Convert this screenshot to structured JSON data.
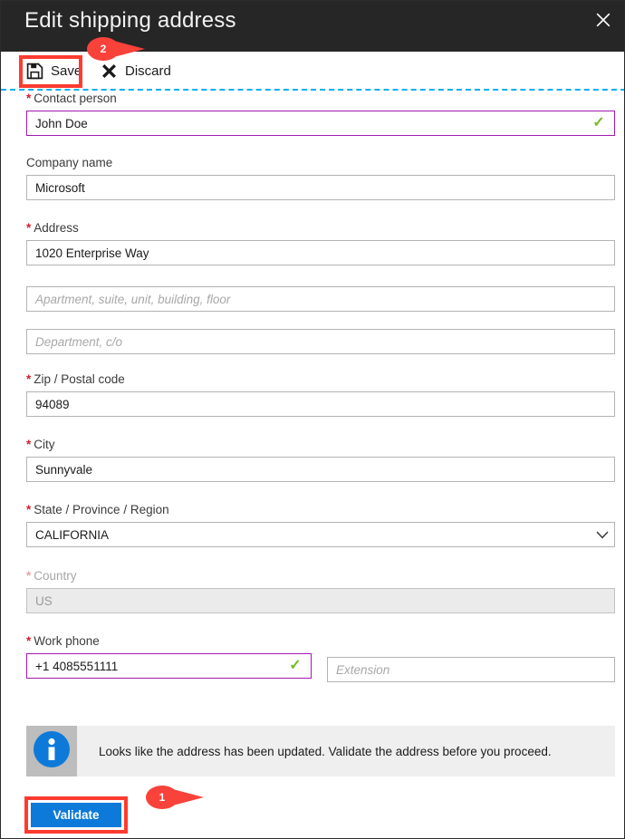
{
  "window": {
    "title": "Edit shipping address",
    "close_icon": "close-icon"
  },
  "toolbar": {
    "save_label": "Save",
    "save_icon": "save-floppy-icon",
    "discard_label": "Discard",
    "discard_icon": "close-x-icon"
  },
  "form": {
    "fields": [
      {
        "label": "Contact person",
        "required": true,
        "value": "John Doe",
        "placeholder": "",
        "state": "valid",
        "validated": true,
        "check_glyph": "✓"
      },
      {
        "label": "Company name",
        "required": false,
        "value": "Microsoft",
        "placeholder": "",
        "state": "normal"
      },
      {
        "label": "Address",
        "required": true,
        "value": "1020 Enterprise Way",
        "placeholder": "",
        "state": "normal"
      },
      {
        "label": "",
        "required": false,
        "value": "",
        "placeholder": "Apartment, suite, unit, building, floor",
        "state": "normal"
      },
      {
        "label": "",
        "required": false,
        "value": "",
        "placeholder": "Department, c/o",
        "state": "normal"
      },
      {
        "label": "Zip / Postal code",
        "required": true,
        "value": "94089",
        "placeholder": "",
        "state": "normal"
      },
      {
        "label": "City",
        "required": true,
        "value": "Sunnyvale",
        "placeholder": "",
        "state": "normal"
      },
      {
        "label": "State / Province / Region",
        "required": true,
        "value": "CALIFORNIA",
        "placeholder": "",
        "state": "dropdown",
        "chevron_icon": "chevron-down-icon"
      },
      {
        "label": "Country",
        "required": true,
        "value": "US",
        "placeholder": "",
        "state": "disabled"
      },
      {
        "label": "Work phone",
        "required": true,
        "value": "+1 4085551111",
        "placeholder": "",
        "state": "valid",
        "validated": true,
        "check_glyph": "✓"
      },
      {
        "label": "",
        "required": false,
        "value": "",
        "placeholder": "Extension",
        "state": "normal"
      }
    ]
  },
  "banner": {
    "icon": "info-circle-icon",
    "message": "Looks like the address has been updated. Validate the address before you proceed."
  },
  "actions": {
    "validate_label": "Validate"
  },
  "annotations": [
    {
      "number": "1",
      "target": "validate-button"
    },
    {
      "number": "2",
      "target": "save-button"
    }
  ],
  "colors": {
    "titlebar_bg": "#262626",
    "accent_blue": "#0d7ada",
    "valid_border": "#a019b0",
    "valid_check": "#72bb27",
    "required_star": "#d61d28",
    "separator": "#00b0f0",
    "annotation_red": "#ff3b30",
    "callout_red": "#f9423a",
    "banner_bg": "#efefef",
    "banner_icon_bg": "#bdbdbd",
    "disabled_bg": "#ebebeb"
  }
}
